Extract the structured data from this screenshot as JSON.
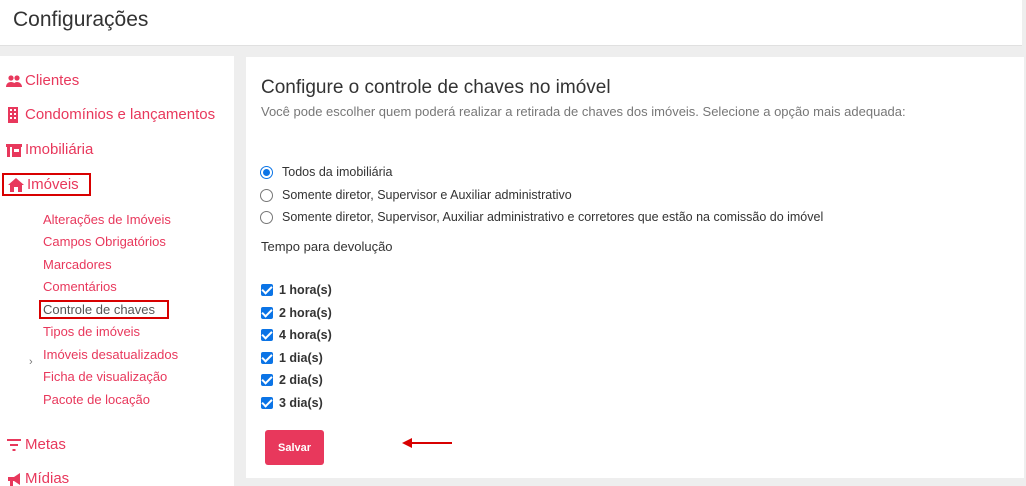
{
  "page": {
    "title": "Configurações"
  },
  "sidebar": {
    "items": [
      {
        "label": "Clientes",
        "icon": "users-icon"
      },
      {
        "label": "Condomínios e lançamentos",
        "icon": "building-icon"
      },
      {
        "label": "Imobiliária",
        "icon": "office-icon"
      },
      {
        "label": "Imóveis",
        "icon": "home-icon"
      },
      {
        "label": "Metas",
        "icon": "filter-icon"
      },
      {
        "label": "Mídias",
        "icon": "megaphone-icon"
      }
    ],
    "subitems": [
      "Alterações de Imóveis",
      "Campos Obrigatórios",
      "Marcadores",
      "Comentários",
      "Controle de chaves",
      "Tipos de imóveis",
      "Imóveis desatualizados",
      "Ficha de visualização",
      "Pacote de locação"
    ],
    "active_subitem": "Controle de chaves"
  },
  "main": {
    "title": "Configure o controle de chaves no imóvel",
    "subtitle": "Você pode escolher quem poderá realizar a retirada de chaves dos imóveis. Selecione a opção mais adequada:",
    "options": [
      {
        "label": "Todos da imobiliária",
        "selected": true
      },
      {
        "label": "Somente diretor, Supervisor e Auxiliar administrativo",
        "selected": false
      },
      {
        "label": "Somente diretor, Supervisor, Auxiliar administrativo e corretores que estão na comissão do imóvel",
        "selected": false
      }
    ],
    "tempo_label": "Tempo para devolução",
    "tempos": [
      {
        "label": "1 hora(s)",
        "checked": true
      },
      {
        "label": "2 hora(s)",
        "checked": true
      },
      {
        "label": "4 hora(s)",
        "checked": true
      },
      {
        "label": "1 dia(s)",
        "checked": true
      },
      {
        "label": "2 dia(s)",
        "checked": true
      },
      {
        "label": "3 dia(s)",
        "checked": true
      }
    ],
    "save_label": "Salvar"
  },
  "colors": {
    "accent": "#e8385c",
    "highlight": "#d80000",
    "control": "#0b74e6"
  }
}
